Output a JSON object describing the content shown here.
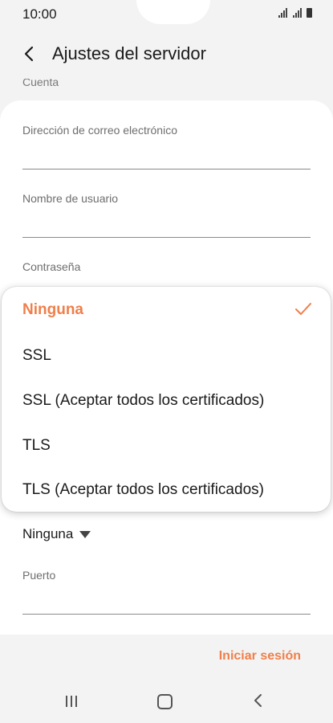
{
  "status_bar": {
    "time": "10:00"
  },
  "header": {
    "title": "Ajustes del servidor"
  },
  "section": {
    "label": "Cuenta"
  },
  "form": {
    "email_label": "Dirección de correo electrónico",
    "username_label": "Nombre de usuario",
    "password_label": "Contraseña",
    "security_value": "Ninguna",
    "port_label": "Puerto"
  },
  "dropdown": {
    "options": [
      {
        "label": "Ninguna",
        "selected": true
      },
      {
        "label": "SSL",
        "selected": false
      },
      {
        "label": "SSL (Aceptar todos los certificados)",
        "selected": false
      },
      {
        "label": "TLS",
        "selected": false
      },
      {
        "label": "TLS (Aceptar todos los certificados)",
        "selected": false
      }
    ]
  },
  "actions": {
    "signin_label": "Iniciar sesión"
  },
  "icons": {
    "back": "chevron-left-icon",
    "check": "check-icon",
    "dropdown_caret": "caret-down-icon",
    "nav_recents": "recents-icon",
    "nav_home": "home-icon",
    "nav_back": "back-icon"
  },
  "colors": {
    "accent": "#f07f4a",
    "background": "#f3f3f3",
    "card": "#ffffff"
  }
}
